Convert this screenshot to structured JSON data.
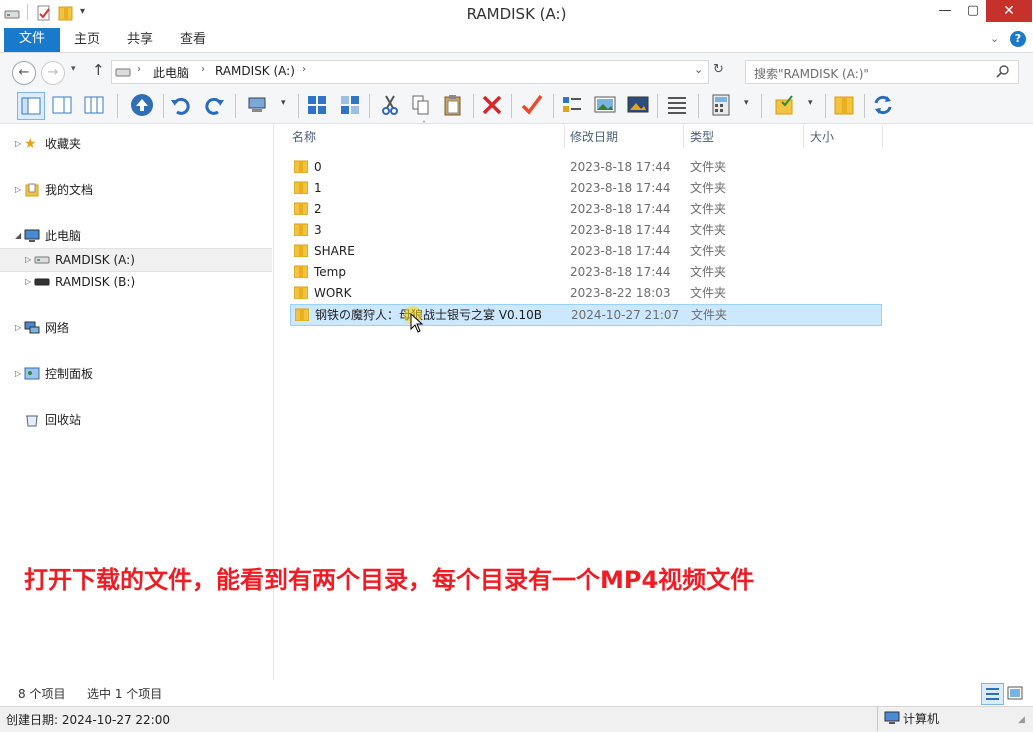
{
  "window": {
    "title": "RAMDISK (A:)",
    "minimize": "—",
    "maximize": "▢",
    "close": "✕"
  },
  "ribbon": {
    "tabs": [
      "文件",
      "主页",
      "共享",
      "查看"
    ]
  },
  "address": {
    "crumbs": [
      "此电脑",
      "RAMDISK (A:)"
    ],
    "search_placeholder": "搜索\"RAMDISK (A:)\""
  },
  "nav": {
    "items": [
      {
        "label": "收藏夹"
      },
      {
        "label": "我的文档"
      },
      {
        "label": "此电脑"
      },
      {
        "label": "RAMDISK (A:)"
      },
      {
        "label": "RAMDISK (B:)"
      },
      {
        "label": "网络"
      },
      {
        "label": "控制面板"
      },
      {
        "label": "回收站"
      }
    ]
  },
  "columns": [
    "名称",
    "修改日期",
    "类型",
    "大小"
  ],
  "files": [
    {
      "name": "0",
      "date": "2023-8-18 17:44",
      "type": "文件夹"
    },
    {
      "name": "1",
      "date": "2023-8-18 17:44",
      "type": "文件夹"
    },
    {
      "name": "2",
      "date": "2023-8-18 17:44",
      "type": "文件夹"
    },
    {
      "name": "3",
      "date": "2023-8-18 17:44",
      "type": "文件夹"
    },
    {
      "name": "SHARE",
      "date": "2023-8-18 17:44",
      "type": "文件夹"
    },
    {
      "name": "Temp",
      "date": "2023-8-18 17:44",
      "type": "文件夹"
    },
    {
      "name": "WORK",
      "date": "2023-8-22 18:03",
      "type": "文件夹"
    },
    {
      "name": "钢铁の魔狩人：母狼战士银亏之宴 V0.10B",
      "date": "2024-10-27 21:07",
      "type": "文件夹"
    }
  ],
  "status": {
    "count": "8 个项目",
    "selected": "选中 1 个项目",
    "created": "创建日期: 2024-10-27 22:00",
    "computer": "计算机"
  },
  "caption": "打开下载的文件，能看到有两个目录，每个目录有一个MP4视频文件",
  "colors": {
    "accent": "#1979ca",
    "selection": "#cce8ff",
    "caption": "#ee1c24",
    "close": "#c7312b"
  }
}
